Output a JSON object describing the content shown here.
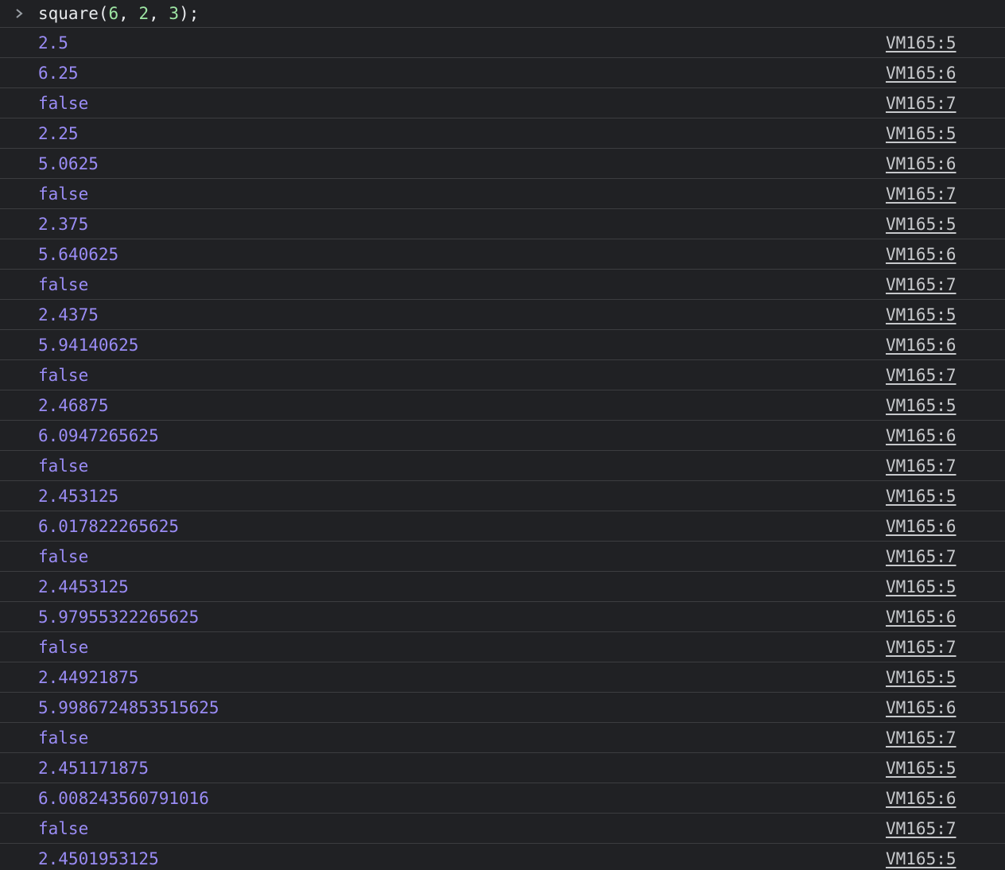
{
  "input": {
    "prefix": "square(",
    "arg1": "6",
    "sep1": ", ",
    "arg2": "2",
    "sep2": ", ",
    "arg3": "3",
    "suffix": ");"
  },
  "logs": [
    {
      "value": "2.5",
      "source": "VM165:5"
    },
    {
      "value": "6.25",
      "source": "VM165:6"
    },
    {
      "value": "false",
      "source": "VM165:7"
    },
    {
      "value": "2.25",
      "source": "VM165:5"
    },
    {
      "value": "5.0625",
      "source": "VM165:6"
    },
    {
      "value": "false",
      "source": "VM165:7"
    },
    {
      "value": "2.375",
      "source": "VM165:5"
    },
    {
      "value": "5.640625",
      "source": "VM165:6"
    },
    {
      "value": "false",
      "source": "VM165:7"
    },
    {
      "value": "2.4375",
      "source": "VM165:5"
    },
    {
      "value": "5.94140625",
      "source": "VM165:6"
    },
    {
      "value": "false",
      "source": "VM165:7"
    },
    {
      "value": "2.46875",
      "source": "VM165:5"
    },
    {
      "value": "6.0947265625",
      "source": "VM165:6"
    },
    {
      "value": "false",
      "source": "VM165:7"
    },
    {
      "value": "2.453125",
      "source": "VM165:5"
    },
    {
      "value": "6.017822265625",
      "source": "VM165:6"
    },
    {
      "value": "false",
      "source": "VM165:7"
    },
    {
      "value": "2.4453125",
      "source": "VM165:5"
    },
    {
      "value": "5.97955322265625",
      "source": "VM165:6"
    },
    {
      "value": "false",
      "source": "VM165:7"
    },
    {
      "value": "2.44921875",
      "source": "VM165:5"
    },
    {
      "value": "5.9986724853515625",
      "source": "VM165:6"
    },
    {
      "value": "false",
      "source": "VM165:7"
    },
    {
      "value": "2.451171875",
      "source": "VM165:5"
    },
    {
      "value": "6.008243560791016",
      "source": "VM165:6"
    },
    {
      "value": "false",
      "source": "VM165:7"
    },
    {
      "value": "2.4501953125",
      "source": "VM165:5"
    }
  ],
  "icons": {
    "prompt": "chevron-right-icon"
  },
  "colors": {
    "background": "#202124",
    "log_value": "#9a8cf5",
    "number_literal": "#9ee6a4",
    "source_link": "#c7c9cc"
  }
}
